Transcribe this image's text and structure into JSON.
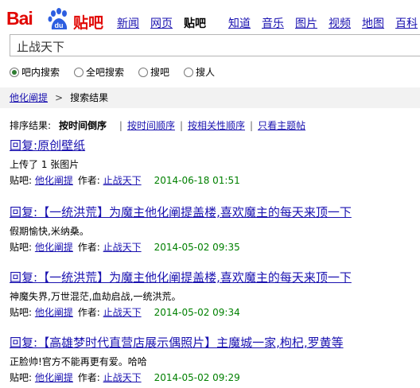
{
  "logo": {
    "bai": "Bai",
    "du": "du",
    "tieba": "贴吧"
  },
  "nav": [
    {
      "label": "新闻",
      "current": false
    },
    {
      "label": "网页",
      "current": false
    },
    {
      "label": "贴吧",
      "current": true
    },
    {
      "label": "知道",
      "current": false
    },
    {
      "label": "音乐",
      "current": false
    },
    {
      "label": "图片",
      "current": false
    },
    {
      "label": "视频",
      "current": false
    },
    {
      "label": "地图",
      "current": false
    },
    {
      "label": "百科",
      "current": false
    }
  ],
  "search": {
    "value": "止战天下"
  },
  "radios": [
    {
      "label": "吧内搜索",
      "checked": true
    },
    {
      "label": "全吧搜索",
      "checked": false
    },
    {
      "label": "搜吧",
      "checked": false
    },
    {
      "label": "搜人",
      "checked": false
    }
  ],
  "breadcrumb": {
    "forum": "他化阐提",
    "sep": ">",
    "current": "搜索结果"
  },
  "sort": {
    "label": "排序结果:",
    "active": "按时间倒序",
    "links": [
      "按时间顺序",
      "按相关性顺序",
      "只看主题帖"
    ]
  },
  "meta_labels": {
    "forum": "贴吧:",
    "author": "作者:"
  },
  "results": [
    {
      "prefix": "回复:",
      "title": "原创壁纸",
      "body": "上传了 1 张图片",
      "forum": "他化阐提",
      "author": "止战天下",
      "date": "2014-06-18 01:51"
    },
    {
      "prefix": "回复:",
      "title": "【一统洪荒】为魔主他化阐提盖楼,喜欢魔主的每天来顶一下",
      "body": "假期愉快,米纳桑。",
      "forum": "他化阐提",
      "author": "止战天下",
      "date": "2014-05-02 09:35"
    },
    {
      "prefix": "回复:",
      "title": "【一统洪荒】为魔主他化阐提盖楼,喜欢魔主的每天来顶一下",
      "body": "神魔失界,万世混茫,血劫启战,一统洪荒。",
      "forum": "他化阐提",
      "author": "止战天下",
      "date": "2014-05-02 09:34"
    },
    {
      "prefix": "回复:",
      "title": "【高雄梦时代直营店展示偶照片】主魔城一家,枸杞,罗黄等",
      "body": "正脸帅!官方不能再更有爱。哈哈",
      "forum": "他化阐提",
      "author": "止战天下",
      "date": "2014-05-02 09:29"
    }
  ]
}
